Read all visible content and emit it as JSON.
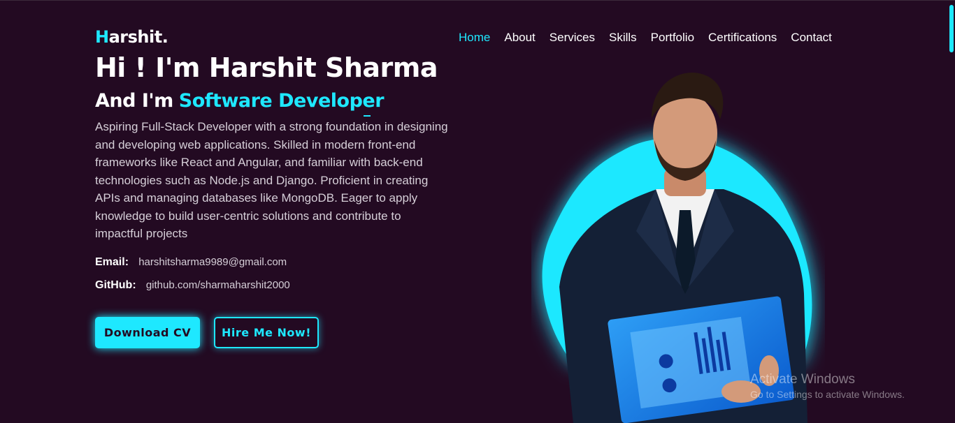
{
  "logo": {
    "accent_letter": "H",
    "rest": "arshit."
  },
  "nav": {
    "items": [
      "Home",
      "About",
      "Services",
      "Skills",
      "Portfolio",
      "Certifications",
      "Contact"
    ],
    "active": "Home"
  },
  "hero": {
    "headline": "Hi ! I'm Harshit Sharma",
    "subhead_prefix": "And I'm",
    "role": "Software Developer",
    "description": "Aspiring Full-Stack Developer with a strong foundation in designing and developing web applications. Skilled in modern front-end frameworks like React and Angular, and familiar with back-end technologies such as Node.js and Django. Proficient in creating APIs and managing databases like MongoDB. Eager to apply knowledge to build user-centric solutions and contribute to impactful projects",
    "email_label": "Email:",
    "email_value": "harshitsharma9989@gmail.com",
    "github_label": "GitHub:",
    "github_value": "github.com/sharmaharshit2000",
    "download_btn": "Download CV",
    "hire_btn": "Hire Me Now!"
  },
  "watermark": {
    "line1": "Activate Windows",
    "line2": "Go to Settings to activate Windows."
  },
  "colors": {
    "background": "#230a22",
    "accent": "#1ee8ff",
    "text": "#ffffff"
  },
  "icons": {
    "portrait": "person-portrait-icon"
  }
}
